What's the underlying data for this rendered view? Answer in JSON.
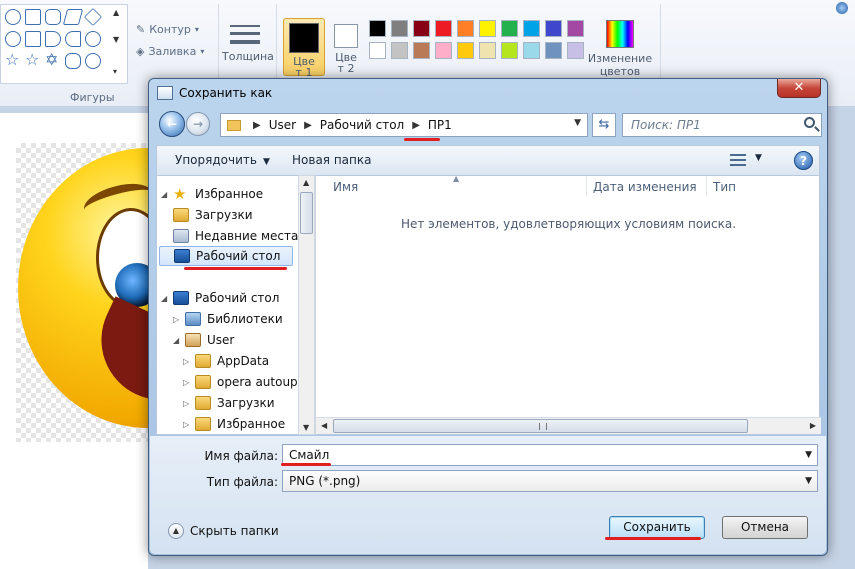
{
  "ribbon": {
    "outline_label": "Контур",
    "fill_label": "Заливка",
    "thickness_label": "Толщина",
    "color1_label": "Цвет 1",
    "color2_label": "Цвет 2",
    "edit_colors_label": "Изменение цветов",
    "shapes_group_label": "Фигуры",
    "palette_row1": [
      "#000000",
      "#7f7f7f",
      "#880015",
      "#ed1c24",
      "#ff7f27",
      "#fff200",
      "#22b14c",
      "#00a2e8",
      "#3f48cc",
      "#a349a4"
    ],
    "palette_row2": [
      "#ffffff",
      "#c3c3c3",
      "#b97a57",
      "#ffaec9",
      "#ffc90e",
      "#efe4b0",
      "#b5e61d",
      "#99d9ea",
      "#7092be",
      "#c8bfe7"
    ]
  },
  "dialog": {
    "title": "Сохранить как",
    "close_symbol": "✕",
    "breadcrumb": [
      "User",
      "Рабочий стол",
      "ПР1"
    ],
    "search_placeholder": "Поиск: ПР1",
    "toolbar": {
      "organize_label": "Упорядочить",
      "new_folder_label": "Новая папка",
      "help_symbol": "?"
    },
    "nav_tree": [
      {
        "label": "Избранное",
        "icon": "star-icon"
      },
      {
        "label": "Загрузки",
        "icon": "downloads-folder-icon"
      },
      {
        "label": "Недавние места",
        "icon": "recent-places-icon"
      },
      {
        "label": "Рабочий стол",
        "icon": "desktop-icon"
      },
      {
        "label": "Рабочий стол",
        "icon": "desktop-icon"
      },
      {
        "label": "Библиотеки",
        "icon": "libraries-icon"
      },
      {
        "label": "User",
        "icon": "user-folder-icon"
      },
      {
        "label": "AppData",
        "icon": "folder-icon"
      },
      {
        "label": "opera autoupd",
        "icon": "folder-icon"
      },
      {
        "label": "Загрузки",
        "icon": "downloads-folder-icon"
      },
      {
        "label": "Избранное",
        "icon": "favorites-folder-icon"
      }
    ],
    "columns": {
      "name": "Имя",
      "date_modified": "Дата изменения",
      "type": "Тип"
    },
    "empty_message": "Нет элементов, удовлетворяющих условиям поиска.",
    "filename_label": "Имя файла:",
    "filename_value": "Смайл",
    "filetype_label": "Тип файла:",
    "filetype_value": "PNG (*.png)",
    "hide_folders_label": "Скрыть папки",
    "save_label": "Сохранить",
    "cancel_label": "Отмена"
  },
  "colors": {
    "accent_underline": "#e21f1f",
    "selection": "#d4e6fb"
  }
}
